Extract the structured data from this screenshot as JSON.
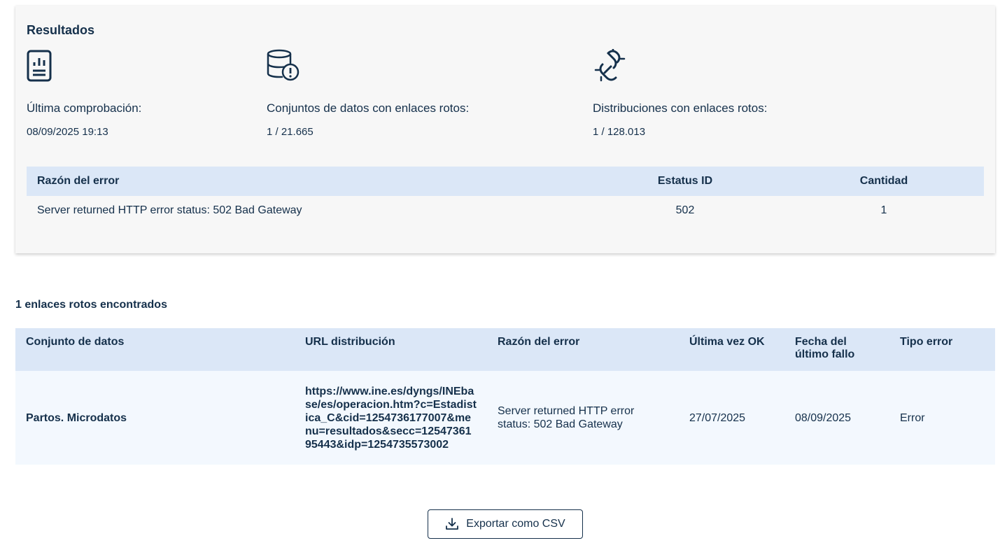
{
  "results": {
    "title": "Resultados",
    "stats": [
      {
        "icon": "report-document-icon",
        "label": "Última comprobación:",
        "value": "08/09/2025 19:13"
      },
      {
        "icon": "database-alert-icon",
        "label": "Conjuntos de datos con enlaces rotos:",
        "value": "1 / 21.665"
      },
      {
        "icon": "broken-link-icon",
        "label": "Distribuciones con enlaces rotos:",
        "value": "1 / 128.013"
      }
    ],
    "summary_table": {
      "headers": [
        "Razón del error",
        "Estatus ID",
        "Cantidad"
      ],
      "rows": [
        [
          "Server returned HTTP error status: 502 Bad Gateway",
          "502",
          "1"
        ]
      ]
    }
  },
  "broken_links": {
    "count_text": "1 enlaces rotos encontrados",
    "headers": [
      "Conjunto de datos",
      "URL distribución",
      "Razón del error",
      "Última vez OK",
      "Fecha del último fallo",
      "Tipo error"
    ],
    "rows": [
      {
        "dataset": "Partos. Microdatos",
        "url": "https://www.ine.es/dyngs/INEbase/es/operacion.htm?c=Estadistica_C&cid=1254736177007&menu=resultados&secc=1254736195443&idp=1254735573002",
        "reason": "Server returned HTTP error status: 502 Bad Gateway",
        "last_ok": "27/07/2025",
        "last_fail": "08/09/2025",
        "error_type": "Error"
      }
    ]
  },
  "export_button": {
    "label": "Exportar como CSV",
    "icon": "download-icon"
  },
  "colors": {
    "primary": "#15304b",
    "header_bg": "#dbe7f7",
    "row_bg": "#f3f8fe",
    "card_bg": "#f7f7f7"
  }
}
